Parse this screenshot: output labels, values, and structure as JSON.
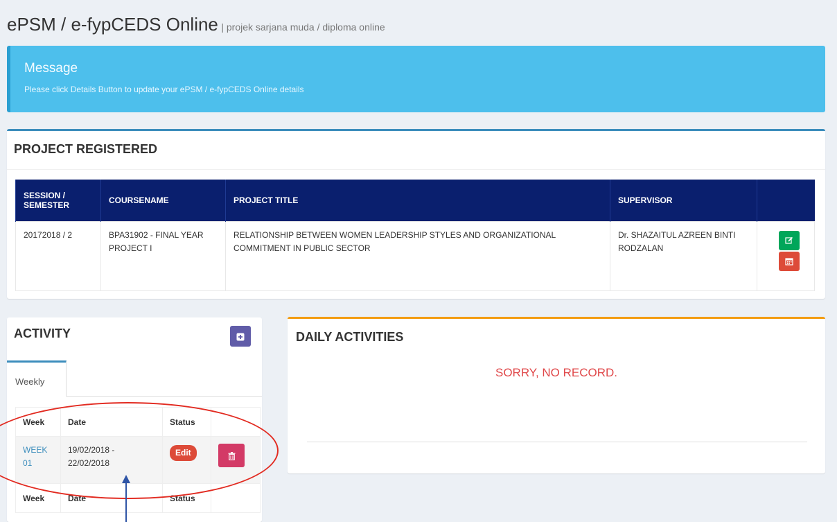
{
  "header": {
    "title": "ePSM / e-fypCEDS Online",
    "subtitle": "| projek sarjana muda / diploma online"
  },
  "message": {
    "title": "Message",
    "text": "Please click Details Button to update your ePSM / e-fypCEDS Online details"
  },
  "project": {
    "title": "PROJECT REGISTERED",
    "columns": [
      "SESSION / SEMESTER",
      "COURSENAME",
      "PROJECT TITLE",
      "SUPERVISOR",
      ""
    ],
    "row": {
      "session": "20172018 / 2",
      "course": "BPA31902 - FINAL YEAR PROJECT I",
      "project_title": "RELATIONSHIP BETWEEN WOMEN LEADERSHIP STYLES AND ORGANIZATIONAL COMMITMENT IN PUBLIC SECTOR",
      "supervisor": "Dr. SHAZAITUL AZREEN BINTI RODZALAN"
    },
    "actions": [
      {
        "icon": "edit-icon",
        "color": "#00a65a"
      },
      {
        "icon": "calendar-icon",
        "color": "#dd4b39"
      }
    ]
  },
  "activity": {
    "title": "ACTIVITY",
    "add_icon": "plus-square-icon",
    "tab_label": "Weekly",
    "columns": [
      "Week",
      "Date",
      "Status"
    ],
    "rows": [
      {
        "week": "WEEK 01",
        "date": "19/02/2018 - 22/02/2018",
        "status": "Edit",
        "delete_icon": "trash-icon"
      }
    ]
  },
  "daily": {
    "title": "DAILY ACTIVITIES",
    "empty_text": "SORRY, NO RECORD."
  },
  "colors": {
    "callout": "#4dbfec",
    "table_header": "#0a1f6e",
    "box_top_blue": "#3c8dbc",
    "box_top_orange": "#f39c12",
    "annotation": "#e22b21",
    "arrow": "#2f55a6"
  }
}
